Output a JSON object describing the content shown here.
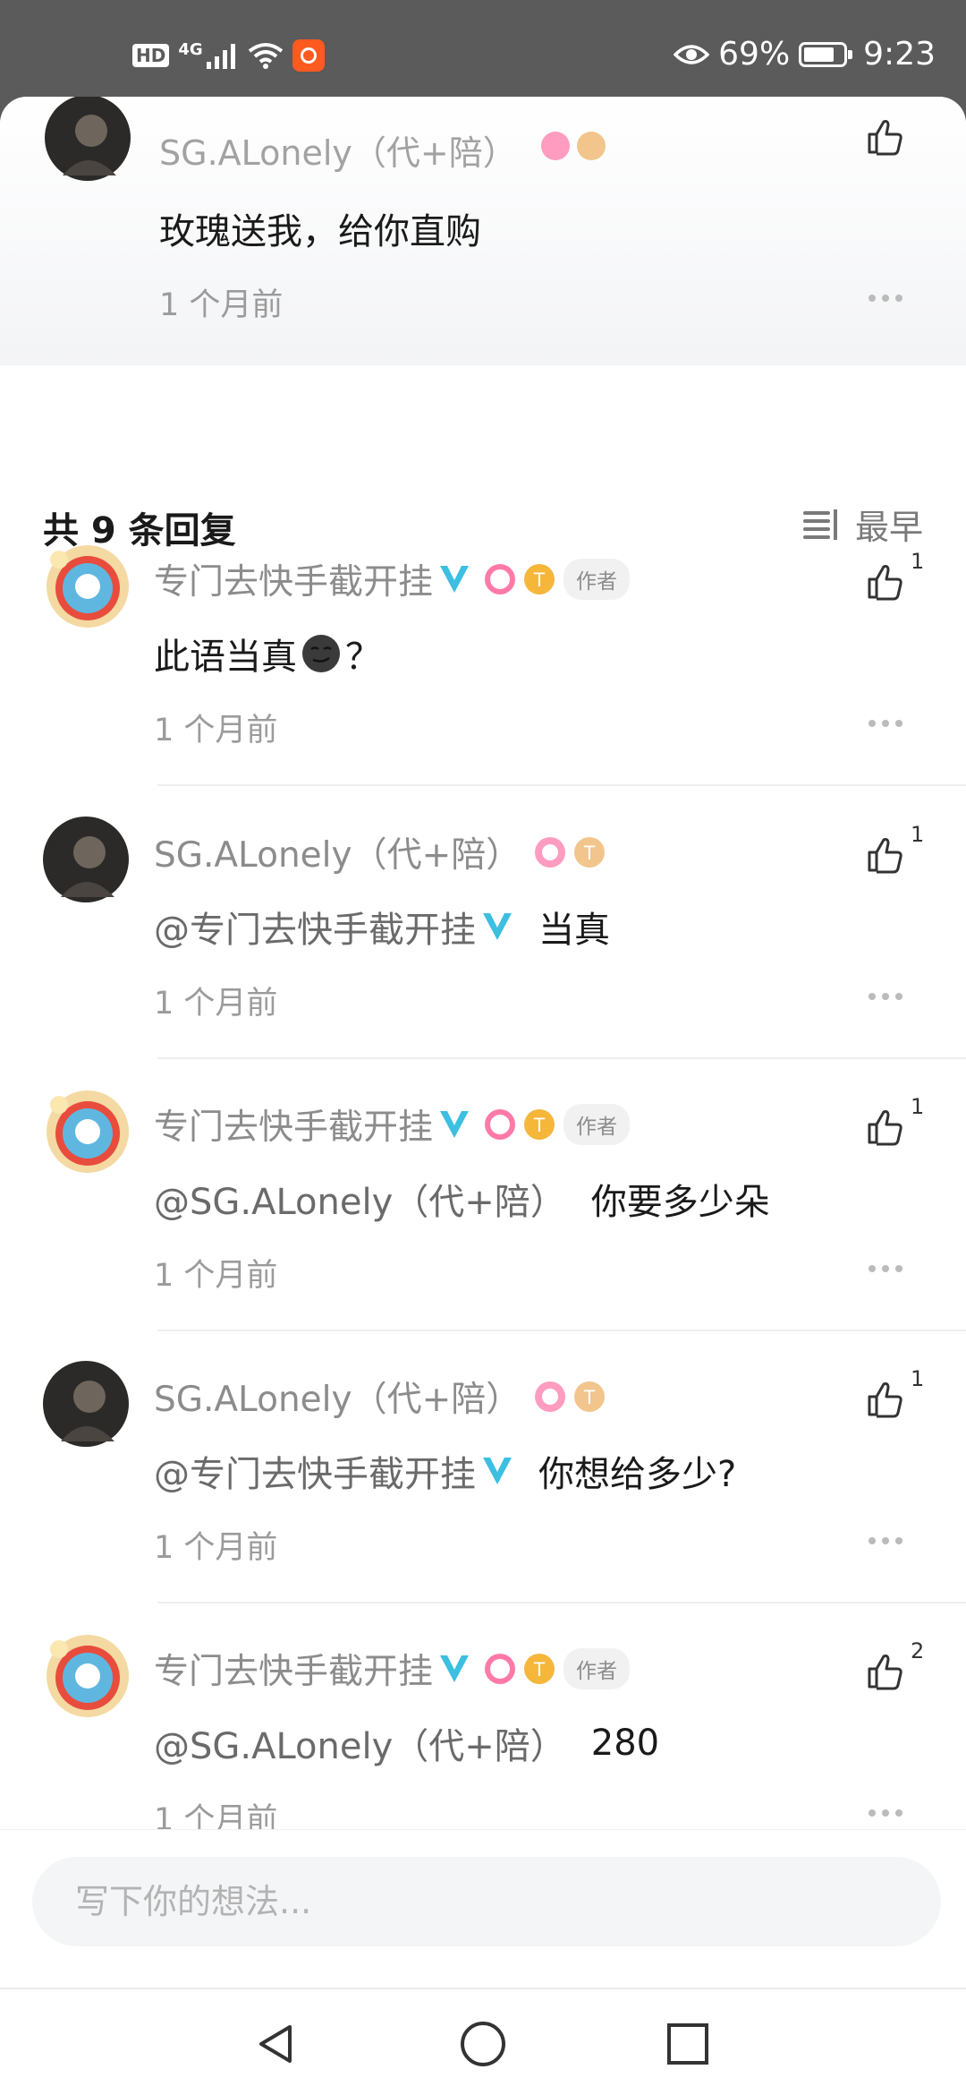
{
  "status_bar": {
    "hd": "HD",
    "network": "4G",
    "battery_percent": "69%",
    "time": "9:23"
  },
  "top_comment": {
    "name": "SG.ALonely（代+陪）",
    "text": "玫瑰送我，给你直购",
    "time": "1 个月前"
  },
  "replies_header": {
    "count_label": "共 9 条回复",
    "sort_label": "最早"
  },
  "replies": [
    {
      "name": "专门去快手截开挂",
      "is_author": true,
      "author_tag": "作者",
      "mention": "",
      "text": "此语当真",
      "suffix": "？",
      "time": "1 个月前",
      "likes": "1"
    },
    {
      "name": "SG.ALonely（代+陪）",
      "is_author": false,
      "mention": "@专门去快手截开挂",
      "text": "当真",
      "time": "1 个月前",
      "likes": "1"
    },
    {
      "name": "专门去快手截开挂",
      "is_author": true,
      "author_tag": "作者",
      "mention": "@SG.ALonely（代+陪）",
      "text": "你要多少朵",
      "time": "1 个月前",
      "likes": "1"
    },
    {
      "name": "SG.ALonely（代+陪）",
      "is_author": false,
      "mention": "@专门去快手截开挂",
      "text": "你想给多少?",
      "time": "1 个月前",
      "likes": "1"
    },
    {
      "name": "专门去快手截开挂",
      "is_author": true,
      "author_tag": "作者",
      "mention": "@SG.ALonely（代+陪）",
      "text": "280",
      "time": "1 个月前",
      "likes": "2"
    }
  ],
  "composer": {
    "placeholder": "写下你的想法..."
  },
  "colors": {
    "verified_blue": "#3cbfe0",
    "badge_pink": "#ff7aa8",
    "badge_gold": "#f5b63a"
  }
}
